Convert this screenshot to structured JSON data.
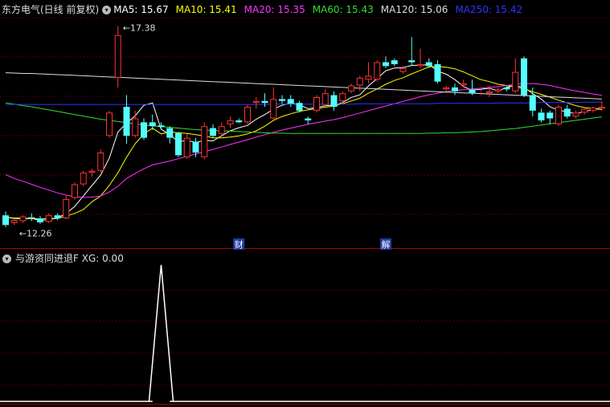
{
  "header": {
    "title": "东方电气(日线 前复权)",
    "ma_items": [
      {
        "label": "MA5: 15.67",
        "color": "#ffffff"
      },
      {
        "label": "MA10: 15.41",
        "color": "#ffff00"
      },
      {
        "label": "MA20: 15.35",
        "color": "#ff33ff"
      },
      {
        "label": "MA60: 15.43",
        "color": "#33dd33"
      },
      {
        "label": "MA120: 15.06",
        "color": "#dddddd"
      },
      {
        "label": "MA250: 15.42",
        "color": "#3333ff"
      }
    ]
  },
  "indicator_header": {
    "title": "与游资同进退F",
    "value_label": "XG: 0.00"
  },
  "annotations": {
    "high_label": "17.38",
    "low_label": "12.26",
    "marker_cai": "财",
    "marker_jie": "解"
  },
  "colors": {
    "up": "#ff3333",
    "down": "#54ffff",
    "grid": "#8b0000",
    "marker_bg": "#1e3ca0"
  },
  "chart_data": {
    "type": "candlestick",
    "ylim": [
      11.8,
      17.6
    ],
    "candles": [
      [
        12.5,
        12.25,
        12.6,
        12.2
      ],
      [
        12.3,
        12.38,
        12.42,
        12.25
      ],
      [
        12.35,
        12.47,
        12.5,
        12.3
      ],
      [
        12.45,
        12.42,
        12.55,
        12.35
      ],
      [
        12.42,
        12.32,
        12.48,
        12.28
      ],
      [
        12.33,
        12.5,
        12.55,
        12.3
      ],
      [
        12.5,
        12.42,
        12.55,
        12.38
      ],
      [
        12.42,
        12.92,
        13.0,
        12.4
      ],
      [
        12.95,
        13.3,
        13.35,
        12.9
      ],
      [
        13.3,
        13.6,
        13.65,
        13.25
      ],
      [
        13.6,
        13.65,
        13.7,
        13.5
      ],
      [
        13.65,
        14.12,
        14.2,
        13.6
      ],
      [
        14.55,
        15.15,
        15.2,
        14.5
      ],
      [
        16.05,
        17.15,
        17.38,
        15.8
      ],
      [
        15.3,
        14.55,
        15.6,
        14.35
      ],
      [
        14.55,
        15.0,
        15.2,
        14.5
      ],
      [
        14.9,
        14.5,
        15.0,
        14.45
      ],
      [
        14.9,
        14.8,
        15.1,
        14.7
      ],
      [
        14.82,
        14.78,
        14.9,
        14.7
      ],
      [
        14.75,
        14.5,
        14.8,
        14.35
      ],
      [
        14.62,
        14.05,
        14.65,
        14.0
      ],
      [
        14.0,
        14.5,
        14.6,
        13.95
      ],
      [
        14.4,
        14.12,
        14.5,
        14.0
      ],
      [
        14.0,
        14.8,
        14.9,
        13.95
      ],
      [
        14.75,
        14.55,
        14.85,
        14.5
      ],
      [
        14.6,
        14.8,
        14.9,
        14.55
      ],
      [
        14.85,
        14.95,
        15.05,
        14.75
      ],
      [
        14.95,
        14.9,
        15.0,
        14.88
      ],
      [
        14.9,
        15.3,
        15.35,
        14.85
      ],
      [
        15.4,
        15.45,
        15.55,
        15.25
      ],
      [
        15.45,
        15.4,
        15.65,
        15.3
      ],
      [
        15.0,
        15.5,
        15.8,
        14.95
      ],
      [
        15.5,
        15.45,
        15.6,
        15.38
      ],
      [
        15.5,
        15.38,
        15.6,
        15.3
      ],
      [
        15.4,
        15.2,
        15.45,
        15.15
      ],
      [
        15.0,
        14.95,
        15.05,
        14.85
      ],
      [
        15.2,
        15.55,
        15.6,
        15.15
      ],
      [
        15.35,
        15.65,
        15.75,
        15.3
      ],
      [
        15.6,
        15.3,
        15.7,
        15.2
      ],
      [
        15.45,
        15.65,
        15.7,
        15.4
      ],
      [
        15.7,
        15.85,
        15.9,
        15.65
      ],
      [
        15.85,
        16.05,
        16.1,
        15.7
      ],
      [
        16.0,
        16.1,
        16.45,
        15.9
      ],
      [
        16.0,
        16.45,
        16.5,
        15.95
      ],
      [
        16.45,
        16.35,
        16.6,
        16.3
      ],
      [
        16.5,
        16.4,
        16.55,
        16.35
      ],
      [
        16.2,
        16.3,
        16.35,
        16.15
      ],
      [
        16.5,
        16.45,
        17.1,
        16.35
      ],
      [
        16.35,
        16.4,
        16.8,
        16.3
      ],
      [
        16.45,
        16.35,
        16.55,
        16.3
      ],
      [
        16.4,
        15.95,
        16.5,
        15.9
      ],
      [
        15.75,
        15.8,
        15.85,
        15.7
      ],
      [
        15.8,
        15.7,
        15.9,
        15.6
      ],
      [
        15.85,
        15.9,
        16.0,
        15.8
      ],
      [
        15.75,
        15.65,
        16.0,
        15.6
      ],
      [
        15.7,
        15.7,
        15.75,
        15.6
      ],
      [
        15.65,
        15.7,
        15.85,
        15.55
      ],
      [
        15.7,
        15.75,
        15.8,
        15.65
      ],
      [
        15.8,
        15.75,
        15.85,
        15.7
      ],
      [
        15.7,
        16.2,
        16.55,
        15.65
      ],
      [
        16.55,
        15.6,
        16.6,
        15.55
      ],
      [
        15.6,
        15.2,
        15.8,
        15.05
      ],
      [
        15.15,
        14.95,
        15.25,
        14.9
      ],
      [
        15.15,
        15.0,
        15.2,
        14.85
      ],
      [
        14.85,
        15.3,
        15.35,
        14.8
      ],
      [
        15.25,
        15.05,
        15.35,
        15.0
      ],
      [
        15.05,
        15.15,
        15.2,
        15.0
      ],
      [
        15.15,
        15.25,
        15.3,
        15.1
      ],
      [
        15.2,
        15.28,
        15.3,
        15.15
      ],
      [
        15.25,
        15.3,
        15.45,
        15.2
      ]
    ],
    "series": [
      {
        "name": "MA5",
        "color": "#ffffff",
        "values": [
          12.45,
          12.42,
          12.41,
          12.42,
          12.37,
          12.39,
          12.43,
          12.55,
          12.73,
          13.0,
          13.27,
          13.54,
          13.98,
          14.65,
          14.88,
          15.07,
          15.34,
          15.4,
          14.72,
          14.58,
          14.4,
          14.43,
          14.38,
          14.43,
          14.42,
          14.55,
          14.68,
          14.76,
          14.82,
          14.98,
          15.1,
          15.24,
          15.34,
          15.4,
          15.35,
          15.25,
          15.28,
          15.33,
          15.34,
          15.41,
          15.54,
          15.61,
          15.84,
          16.03,
          16.23,
          16.3,
          16.31,
          16.37,
          16.37,
          16.39,
          16.22,
          16.14,
          16.0,
          15.82,
          15.73,
          15.75,
          15.78,
          15.71,
          15.8,
          15.85,
          15.8,
          15.64,
          15.5,
          15.3,
          15.21,
          15.17,
          15.12,
          15.18,
          15.23,
          15.27
        ]
      },
      {
        "name": "MA10",
        "color": "#ffff00",
        "values": [
          12.45,
          12.43,
          12.43,
          12.42,
          12.41,
          12.42,
          12.42,
          12.48,
          12.55,
          12.65,
          12.85,
          13.0,
          13.27,
          13.6,
          14.0,
          14.35,
          14.6,
          14.75,
          14.6,
          14.65,
          14.63,
          14.61,
          14.58,
          14.55,
          14.5,
          14.5,
          14.52,
          14.55,
          14.6,
          14.68,
          14.8,
          14.95,
          15.05,
          15.12,
          15.18,
          15.22,
          15.25,
          15.29,
          15.32,
          15.38,
          15.45,
          15.52,
          15.65,
          15.76,
          15.88,
          15.98,
          16.05,
          16.15,
          16.24,
          16.33,
          16.34,
          16.32,
          16.28,
          16.2,
          16.1,
          16.0,
          15.95,
          15.88,
          15.85,
          15.82,
          15.76,
          15.69,
          15.62,
          15.55,
          15.47,
          15.4,
          15.33,
          15.28,
          15.25,
          15.23
        ]
      },
      {
        "name": "MA20",
        "color": "#ff33ff",
        "values": [
          13.55,
          13.45,
          13.38,
          13.3,
          13.22,
          13.15,
          13.08,
          13.02,
          12.98,
          12.96,
          12.97,
          13.0,
          13.1,
          13.25,
          13.45,
          13.58,
          13.7,
          13.8,
          13.85,
          13.9,
          13.96,
          14.02,
          14.08,
          14.14,
          14.2,
          14.26,
          14.33,
          14.39,
          14.45,
          14.52,
          14.58,
          14.64,
          14.7,
          14.75,
          14.8,
          14.85,
          14.89,
          14.93,
          14.97,
          15.02,
          15.08,
          15.14,
          15.2,
          15.26,
          15.32,
          15.38,
          15.44,
          15.5,
          15.56,
          15.61,
          15.65,
          15.69,
          15.72,
          15.74,
          15.76,
          15.78,
          15.8,
          15.82,
          15.85,
          15.88,
          15.9,
          15.9,
          15.88,
          15.85,
          15.8,
          15.75,
          15.71,
          15.67,
          15.63,
          15.6
        ]
      },
      {
        "name": "MA60",
        "color": "#33dd33",
        "values": [
          15.4,
          15.37,
          15.33,
          15.3,
          15.26,
          15.22,
          15.18,
          15.14,
          15.1,
          15.06,
          15.02,
          14.98,
          14.95,
          14.92,
          14.89,
          14.86,
          14.83,
          14.81,
          14.79,
          14.77,
          14.75,
          14.73,
          14.71,
          14.7,
          14.69,
          14.68,
          14.67,
          14.66,
          14.65,
          14.64,
          14.63,
          14.62,
          14.62,
          14.61,
          14.61,
          14.61,
          14.61,
          14.61,
          14.61,
          14.61,
          14.61,
          14.61,
          14.61,
          14.61,
          14.61,
          14.61,
          14.61,
          14.61,
          14.61,
          14.62,
          14.62,
          14.63,
          14.63,
          14.64,
          14.65,
          14.66,
          14.68,
          14.7,
          14.72,
          14.74,
          14.77,
          14.8,
          14.83,
          14.86,
          14.89,
          14.92,
          14.95,
          14.98,
          15.01,
          15.04
        ]
      },
      {
        "name": "MA120",
        "color": "#dddddd",
        "values": [
          16.18,
          16.17,
          16.16,
          16.16,
          16.15,
          16.14,
          16.13,
          16.12,
          16.11,
          16.1,
          16.09,
          16.08,
          16.07,
          16.06,
          16.05,
          16.04,
          16.03,
          16.02,
          16.01,
          16.0,
          15.99,
          15.98,
          15.97,
          15.96,
          15.95,
          15.94,
          15.93,
          15.92,
          15.91,
          15.9,
          15.89,
          15.88,
          15.87,
          15.86,
          15.85,
          15.84,
          15.83,
          15.82,
          15.81,
          15.8,
          15.79,
          15.78,
          15.77,
          15.76,
          15.75,
          15.74,
          15.73,
          15.72,
          15.71,
          15.7,
          15.69,
          15.68,
          15.67,
          15.66,
          15.65,
          15.64,
          15.63,
          15.62,
          15.61,
          15.6,
          15.59,
          15.58,
          15.57,
          15.56,
          15.55,
          15.54,
          15.53,
          15.52,
          15.51,
          15.5
        ]
      },
      {
        "name": "MA250",
        "color": "#3333ff",
        "values": [
          15.36,
          15.36,
          15.36,
          15.36,
          15.36,
          15.36,
          15.36,
          15.36,
          15.36,
          15.36,
          15.36,
          15.36,
          15.36,
          15.36,
          15.36,
          15.36,
          15.36,
          15.36,
          15.36,
          15.36,
          15.36,
          15.36,
          15.36,
          15.36,
          15.36,
          15.36,
          15.36,
          15.36,
          15.36,
          15.36,
          15.36,
          15.37,
          15.37,
          15.37,
          15.37,
          15.37,
          15.37,
          15.37,
          15.37,
          15.37,
          15.37,
          15.38,
          15.38,
          15.38,
          15.38,
          15.38,
          15.38,
          15.38,
          15.38,
          15.38,
          15.39,
          15.39,
          15.39,
          15.39,
          15.39,
          15.39,
          15.39,
          15.4,
          15.4,
          15.4,
          15.4,
          15.4,
          15.41,
          15.41,
          15.41,
          15.41,
          15.41,
          15.42,
          15.42,
          15.42
        ]
      }
    ],
    "indicator": {
      "name": "XG",
      "ylim": [
        0,
        1
      ],
      "values": [
        0,
        0,
        0,
        0,
        0,
        0,
        0,
        0,
        0,
        0,
        0,
        0,
        0,
        0,
        0,
        0,
        0,
        0,
        1,
        0,
        0,
        0,
        0,
        0,
        0,
        0,
        0,
        0,
        0,
        0,
        0,
        0,
        0,
        0,
        0,
        0,
        0,
        0,
        0,
        0,
        0,
        0,
        0,
        0,
        0,
        0,
        0,
        0,
        0,
        0,
        0,
        0,
        0,
        0,
        0,
        0,
        0,
        0,
        0,
        0,
        0,
        0,
        0,
        0,
        0,
        0,
        0,
        0,
        0,
        0
      ]
    },
    "event_markers": [
      {
        "index": 27,
        "label": "财"
      },
      {
        "index": 44,
        "label": "解"
      }
    ],
    "high_index": 13,
    "low_index": 1
  }
}
